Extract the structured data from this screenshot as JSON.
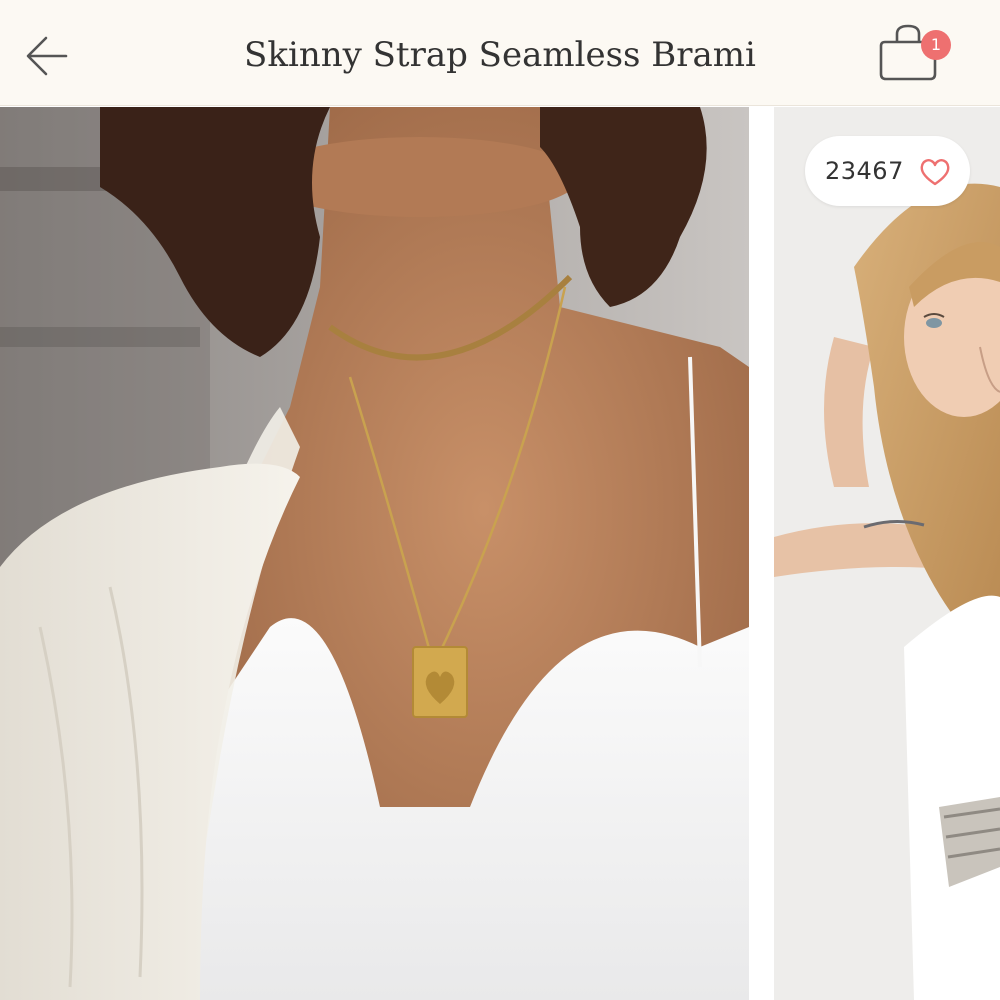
{
  "header": {
    "title": "Skinny Strap Seamless Brami",
    "back_icon": "arrow-left-icon",
    "bag_icon": "shopping-bag-icon",
    "bag_count": "1",
    "badge_color": "#ee7070",
    "background_color": "#fcf9f3"
  },
  "product_images": {
    "likes": {
      "count": "23467",
      "icon": "heart-outline-icon",
      "icon_color": "#ee7070"
    },
    "images": [
      {
        "subject": "model wearing white brami with gold pendant necklace and white shirt"
      },
      {
        "subject": "blonde model wearing white brami with arm raised"
      }
    ]
  }
}
